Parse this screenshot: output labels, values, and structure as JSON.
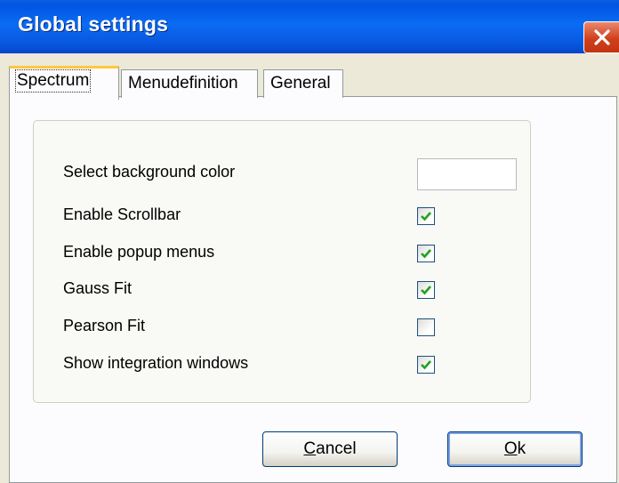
{
  "window": {
    "title": "Global settings"
  },
  "tabs": [
    {
      "label": "Spectrum",
      "active": true
    },
    {
      "label": "Menudefinition",
      "active": false
    },
    {
      "label": "General",
      "active": false
    }
  ],
  "settings": {
    "background_color_label": "Select background color",
    "background_color_value": "#ffffff",
    "options": [
      {
        "label": "Enable Scrollbar",
        "checked": true
      },
      {
        "label": "Enable popup menus",
        "checked": true
      },
      {
        "label": "Gauss Fit",
        "checked": true
      },
      {
        "label": "Pearson Fit",
        "checked": false
      },
      {
        "label": "Show integration windows",
        "checked": true
      }
    ]
  },
  "buttons": {
    "cancel_mnemonic": "C",
    "cancel_rest": "ancel",
    "ok_mnemonic": "O",
    "ok_rest": "k"
  },
  "colors": {
    "titlebar": "#0054e3",
    "check": "#21a121",
    "tab_highlight": "#ffc83c"
  }
}
